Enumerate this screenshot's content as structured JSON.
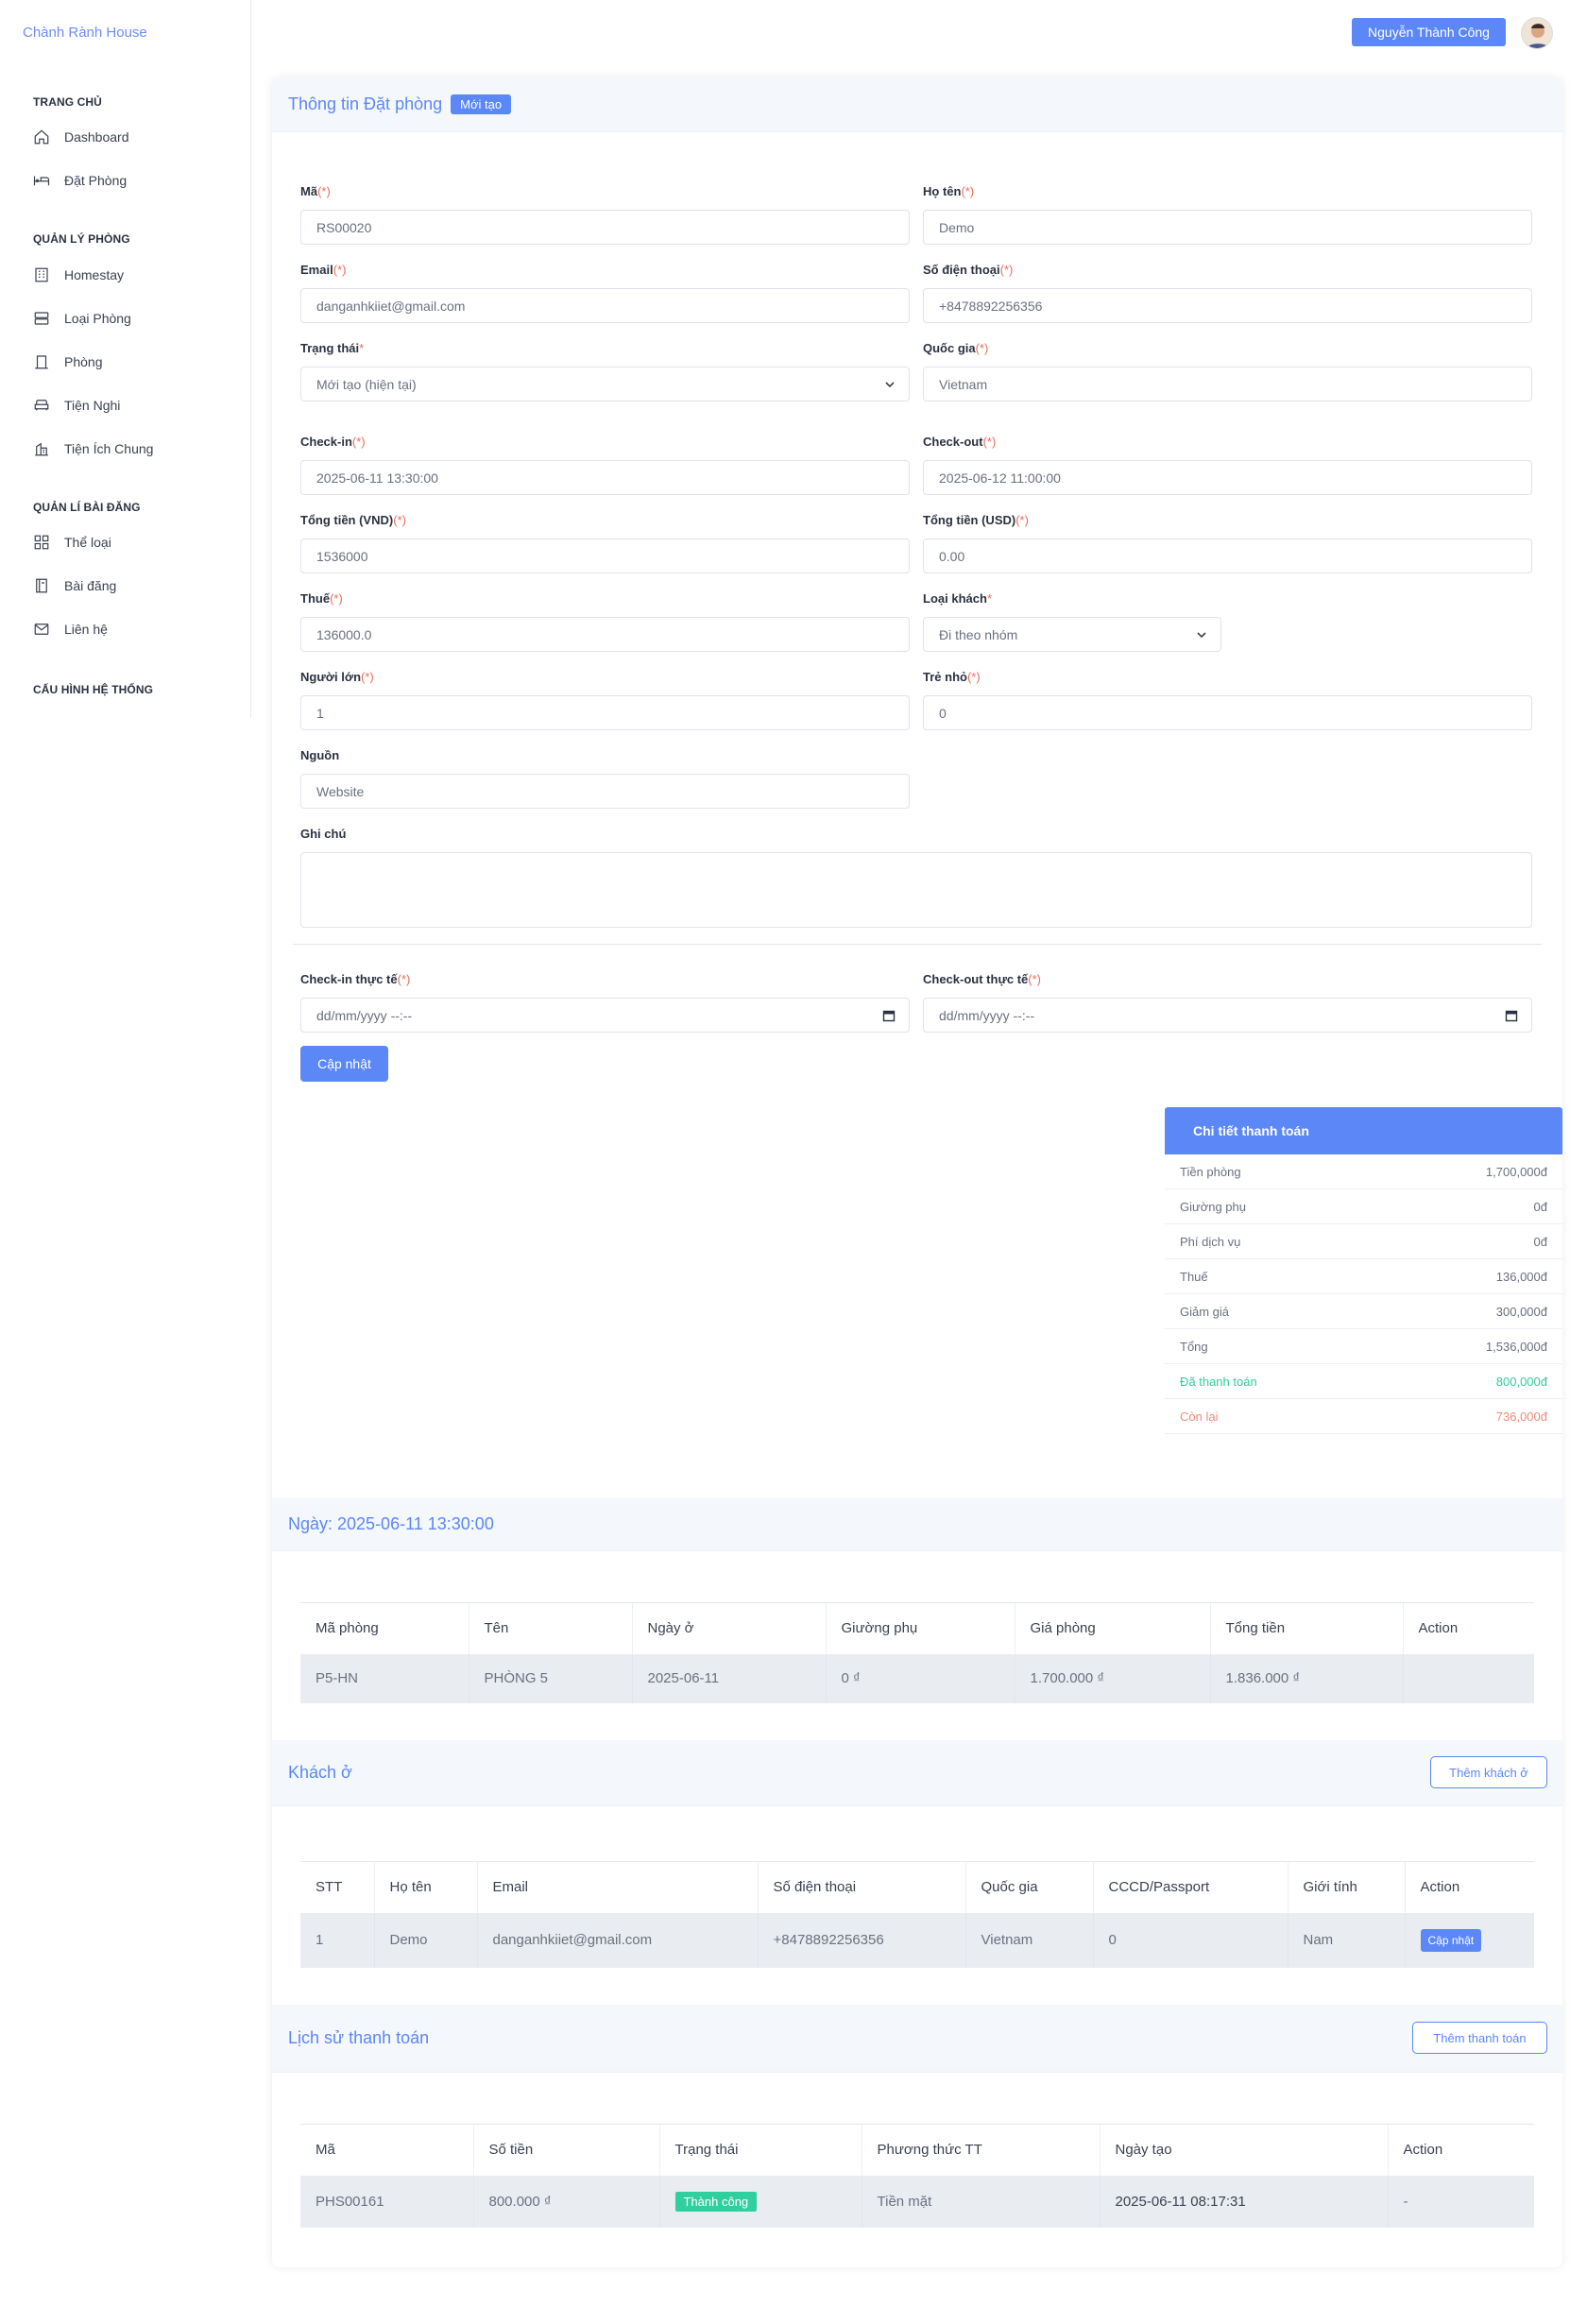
{
  "brand": "Chành Rành House",
  "user": {
    "name": "Nguyễn Thành Công"
  },
  "sidebar": {
    "sections": [
      {
        "title": "TRANG CHỦ",
        "items": [
          {
            "label": "Dashboard",
            "icon": "home-icon"
          },
          {
            "label": "Đặt Phòng",
            "icon": "bed-icon"
          }
        ]
      },
      {
        "title": "QUẢN LÝ PHÒNG",
        "items": [
          {
            "label": "Homestay",
            "icon": "building-icon"
          },
          {
            "label": "Loại Phòng",
            "icon": "server-icon"
          },
          {
            "label": "Phòng",
            "icon": "door-icon"
          },
          {
            "label": "Tiện Nghi",
            "icon": "sofa-icon"
          },
          {
            "label": "Tiện Ích Chung",
            "icon": "city-icon"
          }
        ]
      },
      {
        "title": "QUẢN LÍ BÀI ĐĂNG",
        "items": [
          {
            "label": "Thể loại",
            "icon": "grid-icon"
          },
          {
            "label": "Bài đăng",
            "icon": "book-icon"
          },
          {
            "label": "Liên hệ",
            "icon": "mail-icon"
          }
        ]
      },
      {
        "title": "CẤU HÌNH HỆ THỐNG",
        "items": []
      }
    ]
  },
  "booking": {
    "title": "Thông tin Đặt phòng",
    "badge": "Mới tạo",
    "req_mark": "(*)",
    "req_star": "*",
    "fields": {
      "code": {
        "label": "Mã",
        "value": "RS00020"
      },
      "name": {
        "label": "Họ tên",
        "value": "Demo"
      },
      "email": {
        "label": "Email",
        "value": "danganhkiiet@gmail.com"
      },
      "phone": {
        "label": "Số điện thoại",
        "value": "+8478892256356"
      },
      "status": {
        "label": "Trạng thái",
        "value": "Mới tạo (hiện tại)"
      },
      "country": {
        "label": "Quốc gia",
        "value": "Vietnam"
      },
      "checkin": {
        "label": "Check-in",
        "value": "2025-06-11 13:30:00"
      },
      "checkout": {
        "label": "Check-out",
        "value": "2025-06-12 11:00:00"
      },
      "total_vnd": {
        "label": "Tổng tiền (VND)",
        "value": "1536000"
      },
      "total_usd": {
        "label": "Tổng tiền (USD)",
        "value": "0.00"
      },
      "tax": {
        "label": "Thuế",
        "value": "136000.0"
      },
      "guest_type": {
        "label": "Loại khách",
        "value": "Đi theo nhóm"
      },
      "adults": {
        "label": "Người lớn",
        "value": "1"
      },
      "children": {
        "label": "Trẻ nhỏ",
        "value": "0"
      },
      "source": {
        "label": "Nguồn",
        "value": "Website"
      },
      "note": {
        "label": "Ghi chú",
        "value": ""
      },
      "actual_checkin": {
        "label": "Check-in thực tế",
        "placeholder": "dd/mm/yyyy --:--"
      },
      "actual_checkout": {
        "label": "Check-out thực tế",
        "placeholder": "dd/mm/yyyy --:--"
      }
    },
    "update_button": "Cập nhật"
  },
  "payment_details": {
    "title": "Chi tiết thanh toán",
    "rows": [
      {
        "label": "Tiền phòng",
        "value": "1,700,000đ"
      },
      {
        "label": "Giường phụ",
        "value": "0đ"
      },
      {
        "label": "Phí dịch vụ",
        "value": "0đ"
      },
      {
        "label": "Thuế",
        "value": "136,000đ"
      },
      {
        "label": "Giảm giá",
        "value": "300,000đ"
      },
      {
        "label": "Tổng",
        "value": "1,536,000đ"
      },
      {
        "label": "Đã thanh toán",
        "value": "800,000đ"
      },
      {
        "label": "Còn lại",
        "value": "736,000đ"
      }
    ],
    "colors": {
      "paid": "#33cc99",
      "remaining": "#f08a7a"
    }
  },
  "rooms": {
    "title": "Ngày: 2025-06-11 13:30:00",
    "columns": [
      "Mã phòng",
      "Tên",
      "Ngày ở",
      "Giường phụ",
      "Giá phòng",
      "Tổng tiền",
      "Action"
    ],
    "rows": [
      [
        "P5-HN",
        "PHÒNG 5",
        "2025-06-11",
        "0 ₫",
        "1.700.000 ₫",
        "1.836.000 ₫",
        ""
      ]
    ]
  },
  "guests": {
    "title": "Khách ở",
    "add_button": "Thêm khách ở",
    "columns": [
      "STT",
      "Họ tên",
      "Email",
      "Số điện thoại",
      "Quốc gia",
      "CCCD/Passport",
      "Giới tính",
      "Action"
    ],
    "rows": [
      [
        "1",
        "Demo",
        "danganhkiiet@gmail.com",
        "+8478892256356",
        "Vietnam",
        "0",
        "Nam"
      ]
    ],
    "row_action": "Cập nhật"
  },
  "payments": {
    "title": "Lịch sử thanh toán",
    "add_button": "Thêm thanh toán",
    "columns": [
      "Mã",
      "Số tiền",
      "Trạng thái",
      "Phương thức TT",
      "Ngày tạo",
      "Action"
    ],
    "rows": [
      {
        "code": "PHS00161",
        "amount": "800.000 ₫",
        "status": "Thành công",
        "method": "Tiền mặt",
        "created": "2025-06-11 08:17:31",
        "action": "-"
      }
    ]
  },
  "accent_color": "#5b87f7"
}
